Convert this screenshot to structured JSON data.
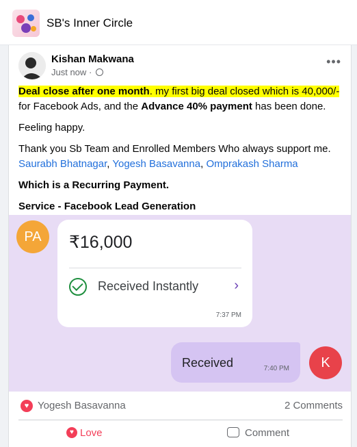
{
  "group": {
    "name": "SB's Inner Circle"
  },
  "post": {
    "author": "Kishan Makwana",
    "time": "Just now",
    "separator": "·",
    "more_icon": "•••",
    "headline": "Deal close after one month",
    "line1_rest": ". my first big deal closed which is 40,000/-",
    "line2_a": "for Facebook Ads, and the ",
    "line2_bold": "Advance 40% payment",
    "line2_b": " has been done.",
    "feeling": "Feeling happy.",
    "thanks": "Thank you Sb Team and Enrolled Members Who always support me.",
    "mentions": [
      "Saurabh Bhatnagar",
      "Yogesh Basavanna",
      "Omprakash Sharma"
    ],
    "recurring": "Which is a Recurring Payment.",
    "service": "Service - Facebook Lead Generation"
  },
  "screenshot": {
    "sender_initials": "PA",
    "amount": "₹16,000",
    "status": "Received Instantly",
    "chevron": "›",
    "time_in": "7:37 PM",
    "reply_text": "Received",
    "time_out": "7:40 PM",
    "receiver_initial": "K"
  },
  "footer": {
    "reactor": "Yogesh Basavanna",
    "comments": "2 Comments",
    "love_label": "Love",
    "comment_label": "Comment"
  },
  "colors": {
    "highlight": "#ffff00",
    "mention": "#216fdb",
    "love": "#f33e58",
    "chat_bg": "#e8dcf5"
  }
}
